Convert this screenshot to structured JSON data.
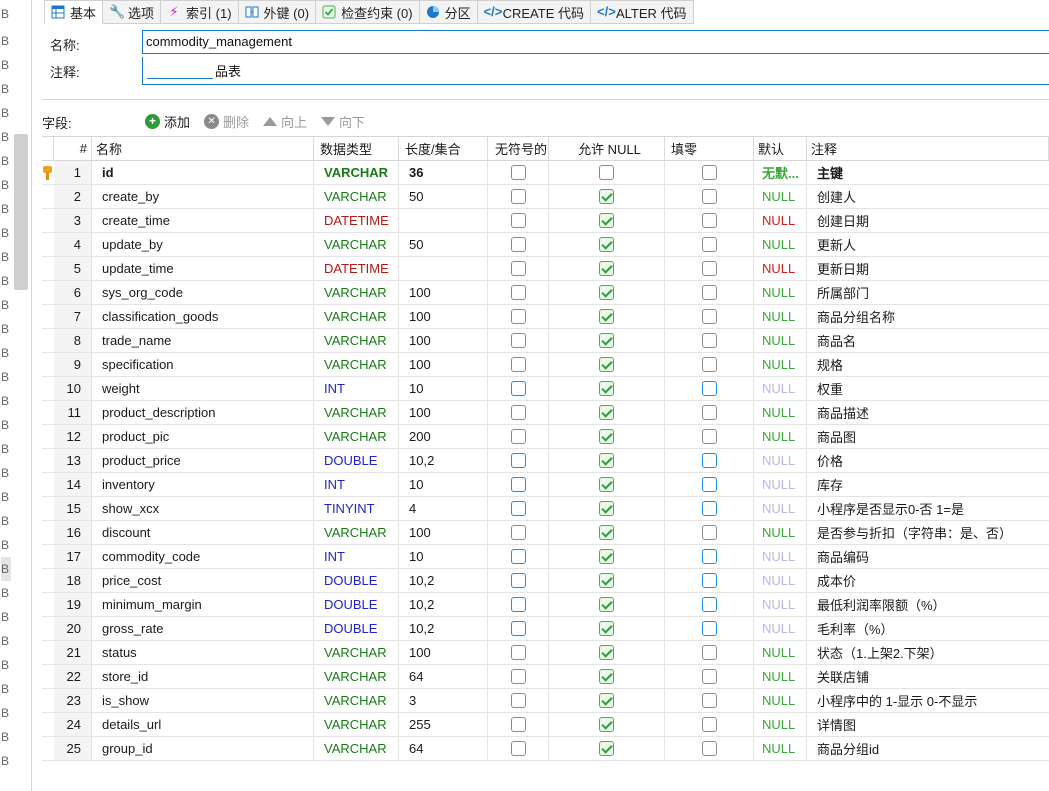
{
  "tabs": [
    {
      "label": "基本",
      "icon": "table-icon",
      "active": true
    },
    {
      "label": "选项",
      "icon": "wrench-icon"
    },
    {
      "label": "索引 (1)",
      "icon": "lightning-icon"
    },
    {
      "label": "外键 (0)",
      "icon": "foreign-key-icon"
    },
    {
      "label": "检查约束 (0)",
      "icon": "check-constraint-icon"
    },
    {
      "label": "分区",
      "icon": "partition-icon"
    },
    {
      "label": "CREATE 代码",
      "icon": "code-icon"
    },
    {
      "label": "ALTER 代码",
      "icon": "code-icon"
    }
  ],
  "form": {
    "name_label": "名称:",
    "name_value": "commodity_management",
    "comment_label": "注释:",
    "comment_value_visible": "品表"
  },
  "toolbar": {
    "fields_label": "字段:",
    "add": "添加",
    "delete": "删除",
    "up": "向上",
    "down": "向下"
  },
  "columns": {
    "num": "#",
    "name": "名称",
    "type": "数据类型",
    "length": "长度/集合",
    "unsigned": "无符号的",
    "nullable": "允许 NULL",
    "zerofill": "填零",
    "default": "默认",
    "comment": "注释"
  },
  "gutter_letter": "B",
  "colors": {
    "varchar": "#1a7a1a",
    "datetime": "#b01818",
    "numeric": "#2222cc",
    "accent": "#1e78c8"
  },
  "rows": [
    {
      "num": "1",
      "name": "id",
      "type": "VARCHAR",
      "length": "36",
      "nullable": false,
      "default": "无默...",
      "comment": "主键"
    },
    {
      "num": "2",
      "name": "create_by",
      "type": "VARCHAR",
      "length": "50",
      "nullable": true,
      "default": "NULL",
      "comment": "创建人"
    },
    {
      "num": "3",
      "name": "create_time",
      "type": "DATETIME",
      "length": "",
      "nullable": true,
      "default": "NULL",
      "comment": "创建日期"
    },
    {
      "num": "4",
      "name": "update_by",
      "type": "VARCHAR",
      "length": "50",
      "nullable": true,
      "default": "NULL",
      "comment": "更新人"
    },
    {
      "num": "5",
      "name": "update_time",
      "type": "DATETIME",
      "length": "",
      "nullable": true,
      "default": "NULL",
      "comment": "更新日期"
    },
    {
      "num": "6",
      "name": "sys_org_code",
      "type": "VARCHAR",
      "length": "100",
      "nullable": true,
      "default": "NULL",
      "comment": "所属部门"
    },
    {
      "num": "7",
      "name": "classification_goods",
      "type": "VARCHAR",
      "length": "100",
      "nullable": true,
      "default": "NULL",
      "comment": "商品分组名称"
    },
    {
      "num": "8",
      "name": "trade_name",
      "type": "VARCHAR",
      "length": "100",
      "nullable": true,
      "default": "NULL",
      "comment": "商品名"
    },
    {
      "num": "9",
      "name": "specification",
      "type": "VARCHAR",
      "length": "100",
      "nullable": true,
      "default": "NULL",
      "comment": "规格"
    },
    {
      "num": "10",
      "name": "weight",
      "type": "INT",
      "length": "10",
      "nullable": true,
      "default": "NULL",
      "comment": "权重"
    },
    {
      "num": "11",
      "name": "product_description",
      "type": "VARCHAR",
      "length": "100",
      "nullable": true,
      "default": "NULL",
      "comment": "商品描述"
    },
    {
      "num": "12",
      "name": "product_pic",
      "type": "VARCHAR",
      "length": "200",
      "nullable": true,
      "default": "NULL",
      "comment": "商品图"
    },
    {
      "num": "13",
      "name": "product_price",
      "type": "DOUBLE",
      "length": "10,2",
      "nullable": true,
      "default": "NULL",
      "comment": "价格"
    },
    {
      "num": "14",
      "name": "inventory",
      "type": "INT",
      "length": "10",
      "nullable": true,
      "default": "NULL",
      "comment": "库存"
    },
    {
      "num": "15",
      "name": "show_xcx",
      "type": "TINYINT",
      "length": "4",
      "nullable": true,
      "default": "NULL",
      "comment": "小程序是否显示0-否 1=是"
    },
    {
      "num": "16",
      "name": "discount",
      "type": "VARCHAR",
      "length": "100",
      "nullable": true,
      "default": "NULL",
      "comment": "是否参与折扣（字符串：是、否）"
    },
    {
      "num": "17",
      "name": "commodity_code",
      "type": "INT",
      "length": "10",
      "nullable": true,
      "default": "NULL",
      "comment": "商品编码"
    },
    {
      "num": "18",
      "name": "price_cost",
      "type": "DOUBLE",
      "length": "10,2",
      "nullable": true,
      "default": "NULL",
      "comment": "成本价"
    },
    {
      "num": "19",
      "name": "minimum_margin",
      "type": "DOUBLE",
      "length": "10,2",
      "nullable": true,
      "default": "NULL",
      "comment": "最低利润率限额（%）"
    },
    {
      "num": "20",
      "name": "gross_rate",
      "type": "DOUBLE",
      "length": "10,2",
      "nullable": true,
      "default": "NULL",
      "comment": "毛利率（%）"
    },
    {
      "num": "21",
      "name": "status",
      "type": "VARCHAR",
      "length": "100",
      "nullable": true,
      "default": "NULL",
      "comment": "状态（1.上架2.下架）"
    },
    {
      "num": "22",
      "name": "store_id",
      "type": "VARCHAR",
      "length": "64",
      "nullable": true,
      "default": "NULL",
      "comment": "关联店铺"
    },
    {
      "num": "23",
      "name": "is_show",
      "type": "VARCHAR",
      "length": "3",
      "nullable": true,
      "default": "NULL",
      "comment": "小程序中的 1-显示 0-不显示"
    },
    {
      "num": "24",
      "name": "details_url",
      "type": "VARCHAR",
      "length": "255",
      "nullable": true,
      "default": "NULL",
      "comment": "详情图"
    },
    {
      "num": "25",
      "name": "group_id",
      "type": "VARCHAR",
      "length": "64",
      "nullable": true,
      "default": "NULL",
      "comment": "商品分组id"
    }
  ]
}
